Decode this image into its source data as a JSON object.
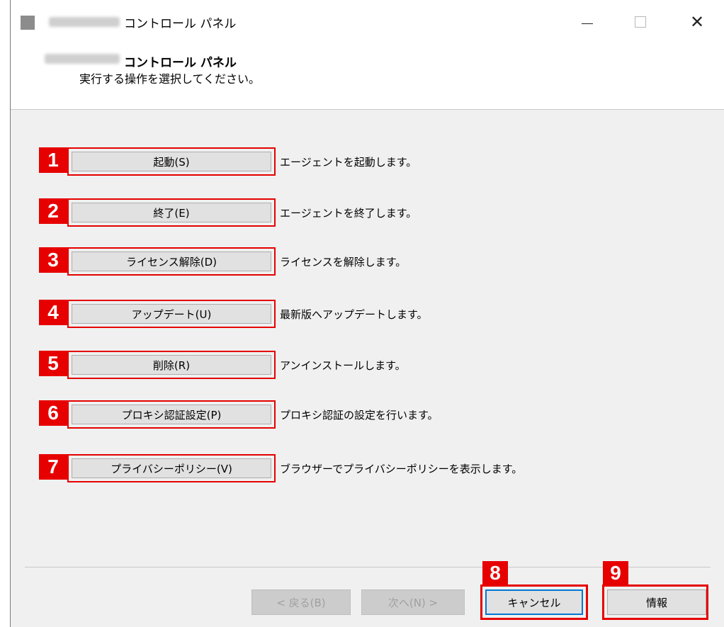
{
  "window": {
    "title": "コントロール パネル",
    "header_title": "コントロール パネル",
    "header_subtitle": "実行する操作を選択してください。"
  },
  "actions": [
    {
      "num": "1",
      "label": "起動(S)",
      "desc": "エージェントを起動します。"
    },
    {
      "num": "2",
      "label": "終了(E)",
      "desc": "エージェントを終了します。"
    },
    {
      "num": "3",
      "label": "ライセンス解除(D)",
      "desc": "ライセンスを解除します。"
    },
    {
      "num": "4",
      "label": "アップデート(U)",
      "desc": "最新版へアップデートします。"
    },
    {
      "num": "5",
      "label": "削除(R)",
      "desc": "アンインストールします。"
    },
    {
      "num": "6",
      "label": "プロキシ認証設定(P)",
      "desc": "プロキシ認証の設定を行います。"
    },
    {
      "num": "7",
      "label": "プライバシーポリシー(V)",
      "desc": "ブラウザーでプライバシーポリシーを表示します。"
    }
  ],
  "footer": {
    "back_label": "< 戻る(B)",
    "next_label": "次へ(N) >",
    "cancel_label": "キャンセル",
    "cancel_num": "8",
    "info_label": "情報",
    "info_num": "9"
  },
  "colors": {
    "highlight": "#e60000",
    "button_face": "#e1e1e1",
    "dialog_bg": "#f0f0f0"
  }
}
